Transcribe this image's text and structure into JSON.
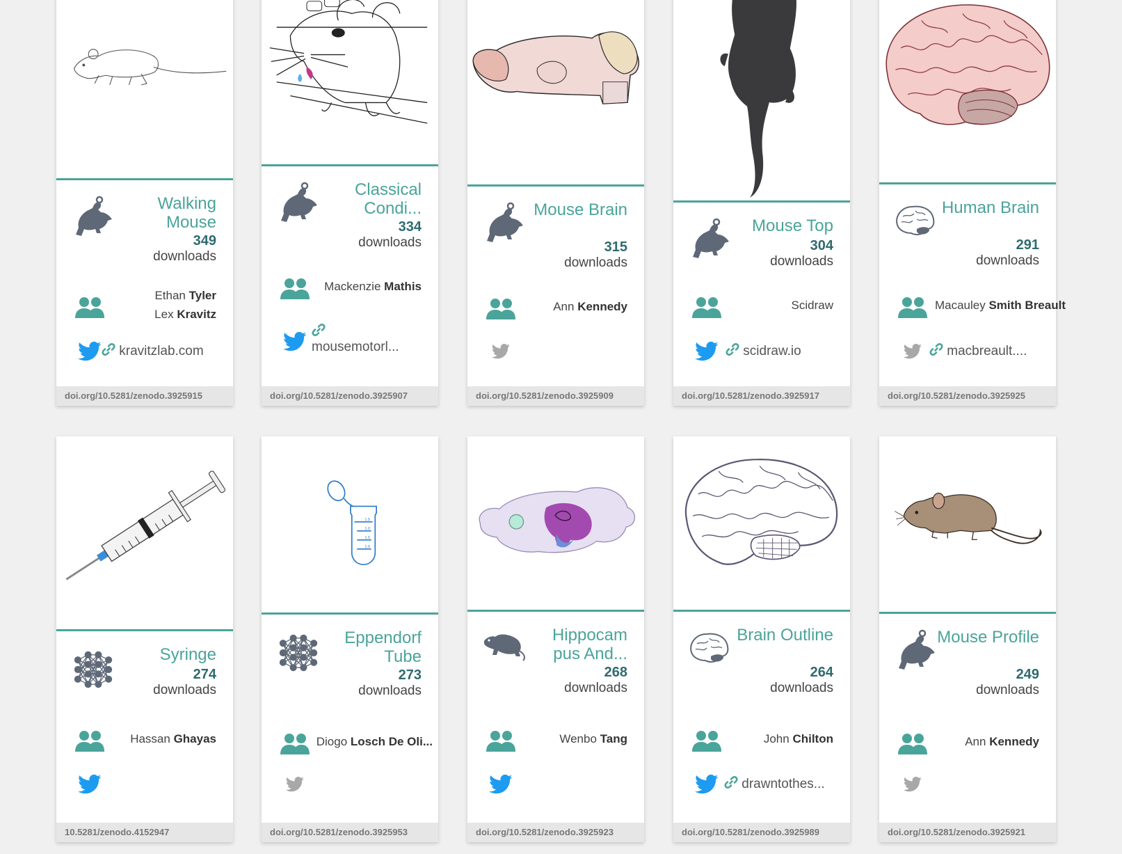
{
  "colors": {
    "accent": "#4aa49a",
    "download_number": "#2f6a6f",
    "twitter_active": "#1d9bf0",
    "twitter_inactive": "#a8a8a8",
    "icon_gray": "#5f6877"
  },
  "cards": [
    {
      "title": "Walking Mouse",
      "downloads": "349",
      "downloads_label": "downloads",
      "authors": [
        {
          "first": "Ethan",
          "last": "Tyler"
        },
        {
          "first": "Lex",
          "last": "Kravitz"
        }
      ],
      "link": "kravitzlab.com",
      "doi": "doi.org/10.5281/zenodo.3925915",
      "category_icon": "mouse-icon",
      "twitter": "active"
    },
    {
      "title": "Classical Condi...",
      "downloads": "334",
      "downloads_label": "downloads",
      "authors": [
        {
          "first": "Mackenzie",
          "last": "Mathis"
        }
      ],
      "link": "mousemotorl...",
      "doi": "doi.org/10.5281/zenodo.3925907",
      "category_icon": "mouse-icon",
      "twitter": "active"
    },
    {
      "title": "Mouse Brain",
      "downloads": "315",
      "downloads_label": "downloads",
      "authors": [
        {
          "first": "Ann",
          "last": "Kennedy"
        }
      ],
      "link": "",
      "doi": "doi.org/10.5281/zenodo.3925909",
      "category_icon": "mouse-icon",
      "twitter": "inactive"
    },
    {
      "title": "Mouse Top",
      "downloads": "304",
      "downloads_label": "downloads",
      "authors": [
        {
          "first": "Scidraw",
          "last": ""
        }
      ],
      "link": "scidraw.io",
      "doi": "doi.org/10.5281/zenodo.3925917",
      "category_icon": "mouse-icon",
      "twitter": "active"
    },
    {
      "title": "Human Brain",
      "downloads": "291",
      "downloads_label": "downloads",
      "authors": [
        {
          "first": "Macauley",
          "last": "Smith Breault"
        }
      ],
      "link": "macbreault....",
      "doi": "doi.org/10.5281/zenodo.3925925",
      "category_icon": "brain-icon",
      "twitter": "inactive"
    },
    {
      "title": "Syringe",
      "downloads": "274",
      "downloads_label": "downloads",
      "authors": [
        {
          "first": "Hassan",
          "last": "Ghayas"
        }
      ],
      "link": "",
      "doi": "10.5281/zenodo.4152947",
      "category_icon": "network-icon",
      "twitter": "active"
    },
    {
      "title": "Eppendorf Tube",
      "downloads": "273",
      "downloads_label": "downloads",
      "authors": [
        {
          "first": "Diogo",
          "last": "Losch De Oli..."
        }
      ],
      "link": "",
      "doi": "doi.org/10.5281/zenodo.3925953",
      "category_icon": "network-icon",
      "twitter": "inactive"
    },
    {
      "title": "Hippocam pus And...",
      "downloads": "268",
      "downloads_label": "downloads",
      "authors": [
        {
          "first": "Wenbo",
          "last": "Tang"
        }
      ],
      "link": "",
      "doi": "doi.org/10.5281/zenodo.3925923",
      "category_icon": "rat-icon",
      "twitter": "active"
    },
    {
      "title": "Brain Outline",
      "downloads": "264",
      "downloads_label": "downloads",
      "authors": [
        {
          "first": "John",
          "last": "Chilton"
        }
      ],
      "link": "drawntothes...",
      "doi": "doi.org/10.5281/zenodo.3925989",
      "category_icon": "brain-icon",
      "twitter": "active"
    },
    {
      "title": "Mouse Profile",
      "downloads": "249",
      "downloads_label": "downloads",
      "authors": [
        {
          "first": "Ann",
          "last": "Kennedy"
        }
      ],
      "link": "",
      "doi": "doi.org/10.5281/zenodo.3925921",
      "category_icon": "mouse-icon",
      "twitter": "inactive"
    }
  ]
}
